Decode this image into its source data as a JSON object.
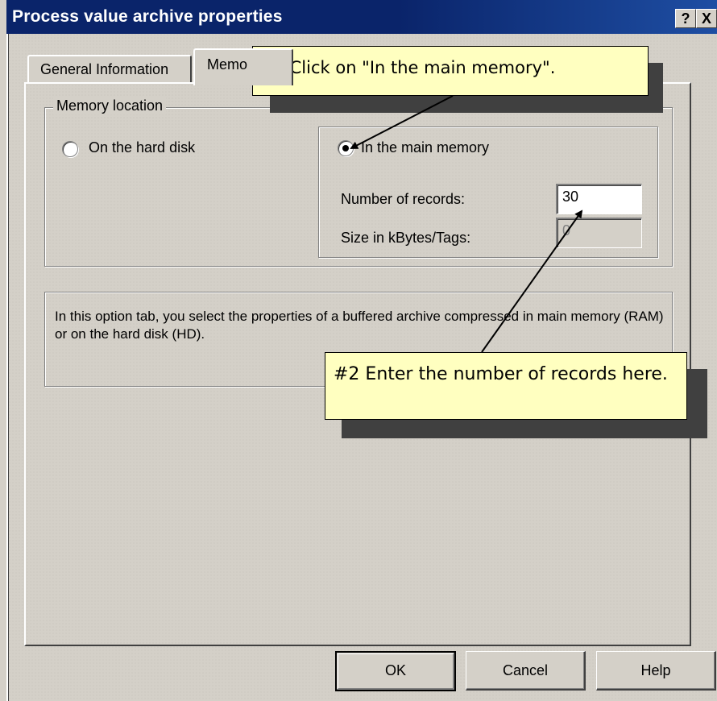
{
  "window": {
    "title": "Process value archive properties",
    "help_button": "?",
    "close_button": "X"
  },
  "tabs": [
    {
      "label": "General Information",
      "active": false
    },
    {
      "label": "Memo",
      "active": true
    }
  ],
  "memory_location": {
    "legend": "Memory location",
    "option_hard_disk": "On the hard disk",
    "option_main_memory": "In the main memory",
    "selected": "In the main memory",
    "number_of_records_label": "Number of records:",
    "number_of_records_value": "30",
    "size_label": "Size in kBytes/Tags:",
    "size_value": "0"
  },
  "info": {
    "text": "In this option tab, you select the properties of a buffered archive compressed in main memory (RAM) or on the hard disk (HD)."
  },
  "buttons": {
    "ok": "OK",
    "cancel": "Cancel",
    "help": "Help"
  },
  "callouts": [
    {
      "text": "#1 Click on \"In the main memory\"."
    },
    {
      "text": "#2 Enter the number of records here."
    }
  ],
  "colors": {
    "titlebar": "#0a246a",
    "dialog_background": "#d4d0c8",
    "callout_background": "#ffffc0",
    "callout_shadow": "#404040"
  }
}
